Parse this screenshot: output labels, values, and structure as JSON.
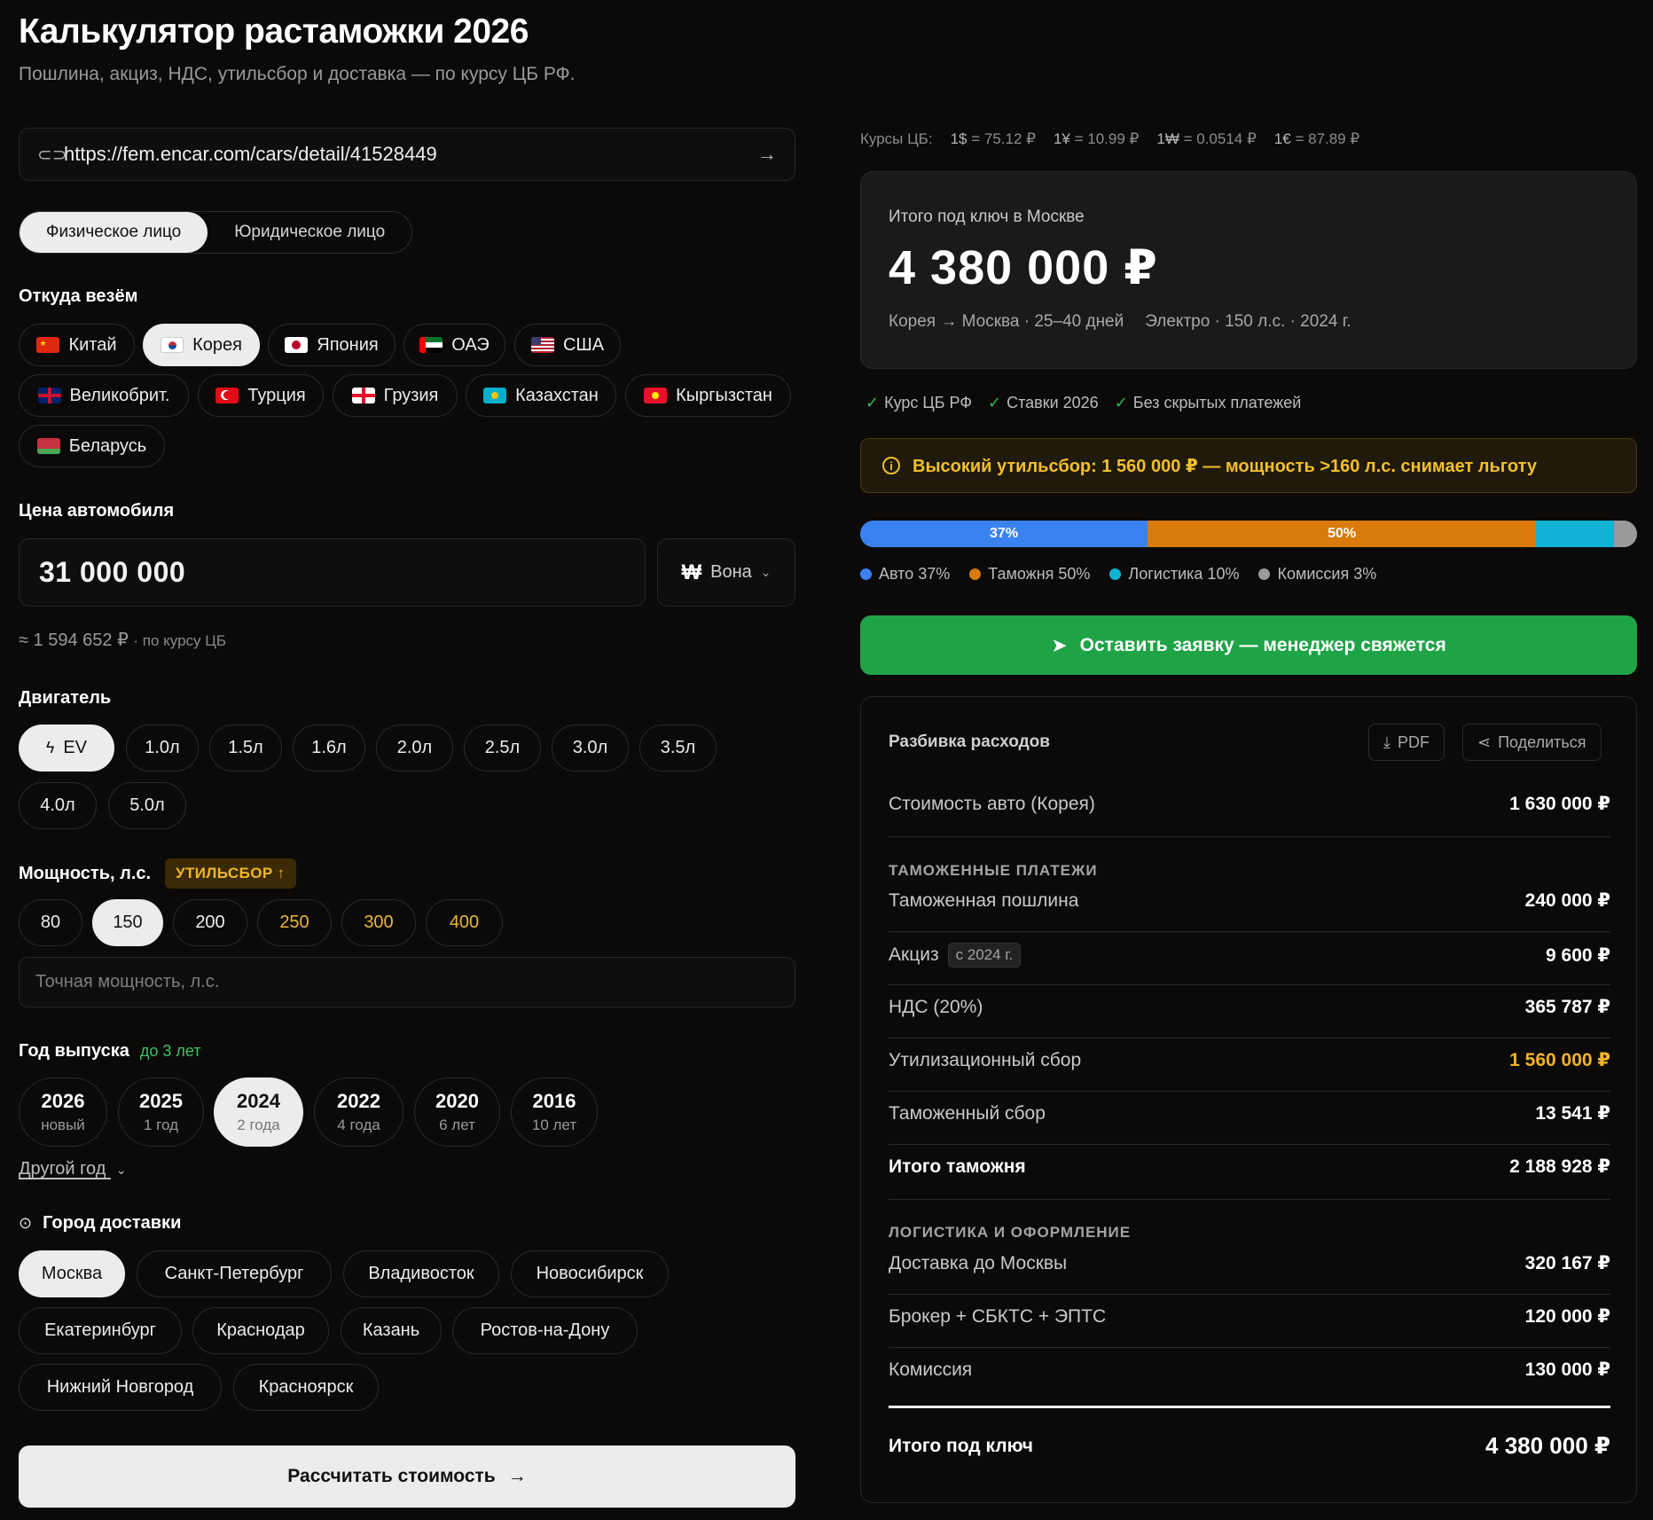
{
  "header": {
    "title": "Калькулятор растаможки 2026",
    "subtitle": "Пошлина, акциз, НДС, утильсбор и доставка — по курсу ЦБ РФ."
  },
  "url_input": {
    "value": "https://fem.encar.com/cars/detail/41528449"
  },
  "person_type": {
    "options": [
      "Физическое лицо",
      "Юридическое лицо"
    ],
    "selected": "Физическое лицо"
  },
  "origin": {
    "label": "Откуда везём",
    "countries": [
      "Китай",
      "Корея",
      "Япония",
      "ОАЭ",
      "США",
      "Великобрит.",
      "Турция",
      "Грузия",
      "Казахстан",
      "Кыргызстан",
      "Беларусь"
    ],
    "selected": "Корея"
  },
  "price": {
    "label": "Цена автомобиля",
    "value": "31 000 000",
    "currency_symbol": "₩",
    "currency": "Вона",
    "approx": "≈ 1 594 652 ₽",
    "approx_note": "· по курсу ЦБ"
  },
  "engine": {
    "label": "Двигатель",
    "options": [
      "EV",
      "1.0л",
      "1.5л",
      "1.6л",
      "2.0л",
      "2.5л",
      "3.0л",
      "3.5л",
      "4.0л",
      "5.0л"
    ],
    "selected": "EV"
  },
  "power": {
    "label": "Мощность, л.с.",
    "tag": "УТИЛЬСБОР ↑",
    "options": [
      "80",
      "150",
      "200",
      "250",
      "300",
      "400"
    ],
    "selected": "150",
    "placeholder": "Точная мощность, л.с."
  },
  "year": {
    "label": "Год выпуска",
    "hint": "до 3 лет",
    "options": [
      {
        "year": "2026",
        "sub": "новый"
      },
      {
        "year": "2025",
        "sub": "1 год"
      },
      {
        "year": "2024",
        "sub": "2 года"
      },
      {
        "year": "2022",
        "sub": "4 года"
      },
      {
        "year": "2020",
        "sub": "6 лет"
      },
      {
        "year": "2016",
        "sub": "10 лет"
      }
    ],
    "selected": "2024",
    "other": "Другой год"
  },
  "city": {
    "label": "Город доставки",
    "options": [
      "Москва",
      "Санкт-Петербург",
      "Владивосток",
      "Новосибирск",
      "Екатеринбург",
      "Краснодар",
      "Казань",
      "Ростов-на-Дону",
      "Нижний Новгород",
      "Красноярск"
    ],
    "selected": "Москва"
  },
  "calc_button": "Рассчитать стоимость",
  "rates": {
    "label": "Курсы ЦБ:",
    "items": [
      {
        "cur": "1$",
        "val": "= 75.12 ₽"
      },
      {
        "cur": "1¥",
        "val": "= 10.99 ₽"
      },
      {
        "cur": "1₩",
        "val": "= 0.0514 ₽"
      },
      {
        "cur": "1€",
        "val": "= 87.89 ₽"
      }
    ]
  },
  "summary": {
    "label": "Итого под ключ в Москве",
    "total": "4 380 000 ₽",
    "route": "Корея → Москва · 25–40 дней",
    "car": "Электро · 150 л.с. · 2024 г."
  },
  "checks": [
    "Курс ЦБ РФ",
    "Ставки 2026",
    "Без скрытых платежей"
  ],
  "warning": "Высокий утильсбор: 1 560 000 ₽ — мощность >160 л.с. снимает льготу",
  "distribution": {
    "segments": [
      {
        "name": "Авто",
        "pct": 37,
        "label": "37%",
        "legend": "Авто 37%",
        "color": "#3a82f0"
      },
      {
        "name": "Таможня",
        "pct": 50,
        "label": "50%",
        "legend": "Таможня 50%",
        "color": "#d97a0a"
      },
      {
        "name": "Логистика",
        "pct": 10,
        "label": "",
        "legend": "Логистика 10%",
        "color": "#11b3d4"
      },
      {
        "name": "Комиссия",
        "pct": 3,
        "label": "",
        "legend": "Комиссия 3%",
        "color": "#9a9a9a"
      }
    ]
  },
  "cta": "Оставить заявку — менеджер свяжется",
  "breakdown": {
    "title": "Разбивка расходов",
    "pdf": "PDF",
    "share": "Поделиться",
    "car_cost": {
      "k": "Стоимость авто (Корея)",
      "v": "1 630 000 ₽"
    },
    "customs_head": "ТАМОЖЕННЫЕ ПЛАТЕЖИ",
    "duty": {
      "k": "Таможенная пошлина",
      "v": "240 000 ₽"
    },
    "excise": {
      "k": "Акциз",
      "tag": "с 2024 г.",
      "v": "9 600 ₽"
    },
    "vat": {
      "k": "НДС (20%)",
      "v": "365 787 ₽"
    },
    "util": {
      "k": "Утилизационный сбор",
      "v": "1 560 000 ₽"
    },
    "fee": {
      "k": "Таможенный сбор",
      "v": "13 541 ₽"
    },
    "customs_total": {
      "k": "Итого таможня",
      "v": "2 188 928 ₽"
    },
    "logistics_head": "ЛОГИСТИКА И ОФОРМЛЕНИЕ",
    "delivery": {
      "k": "Доставка до Москвы",
      "v": "320 167 ₽"
    },
    "broker": {
      "k": "Брокер + СБКТС + ЭПТС",
      "v": "120 000 ₽"
    },
    "commission": {
      "k": "Комиссия",
      "v": "130 000 ₽"
    },
    "grand_total": {
      "k": "Итого под ключ",
      "v": "4 380 000 ₽"
    }
  }
}
